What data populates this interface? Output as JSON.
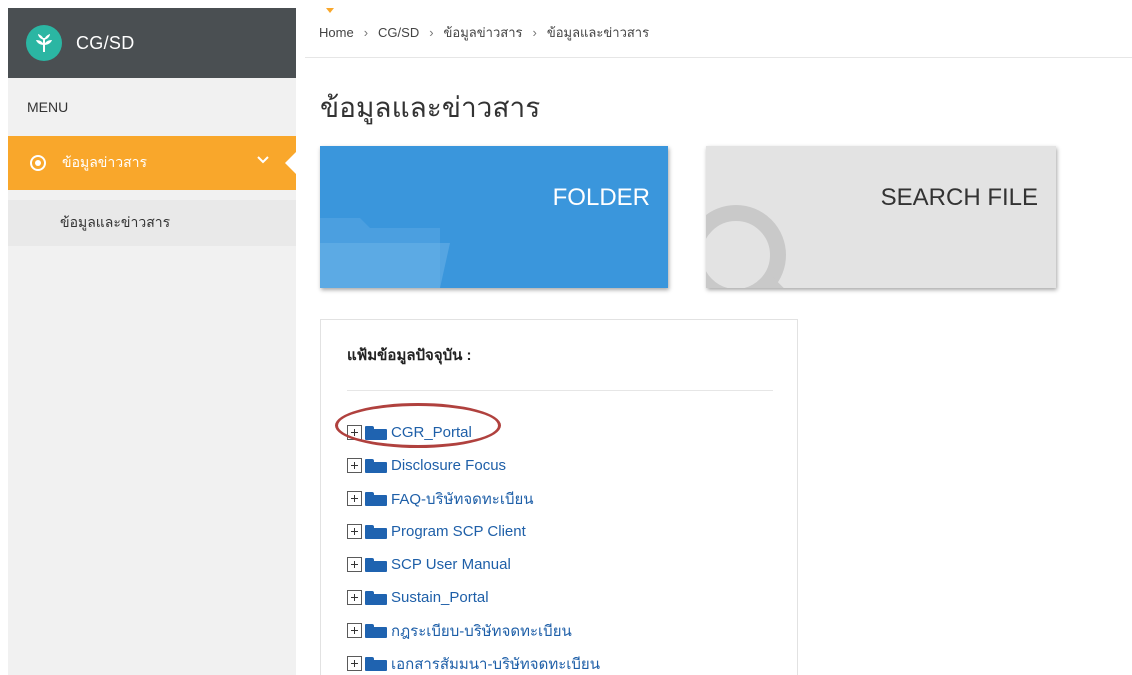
{
  "brand": {
    "name": "CG/SD"
  },
  "sidebar": {
    "menu_label": "MENU",
    "active_item": {
      "label": "ข้อมูลข่าวสาร"
    },
    "sub_items": [
      {
        "label": "ข้อมูลและข่าวสาร"
      }
    ]
  },
  "breadcrumb": [
    "Home",
    "CG/SD",
    "ข้อมูลข่าวสาร",
    "ข้อมูลและข่าวสาร"
  ],
  "page_title": "ข้อมูลและข่าวสาร",
  "tiles": {
    "folder": {
      "label": "FOLDER",
      "color": "#3a96dc"
    },
    "search": {
      "label": "SEARCH FILE",
      "color": "#e3e3e3"
    }
  },
  "panel": {
    "title": "แฟ้มข้อมูลปัจจุบัน :",
    "folders": [
      "CGR_Portal",
      "Disclosure Focus",
      "FAQ-บริษัทจดทะเบียน",
      "Program SCP Client",
      "SCP User Manual",
      "Sustain_Portal",
      "กฎระเบียบ-บริษัทจดทะเบียน",
      "เอกสารสัมมนา-บริษัทจดทะเบียน"
    ]
  },
  "colors": {
    "accent": "#f9a72b",
    "header": "#4a4f52",
    "folder_icon": "#1f63b0",
    "highlight": "#b0413e"
  }
}
